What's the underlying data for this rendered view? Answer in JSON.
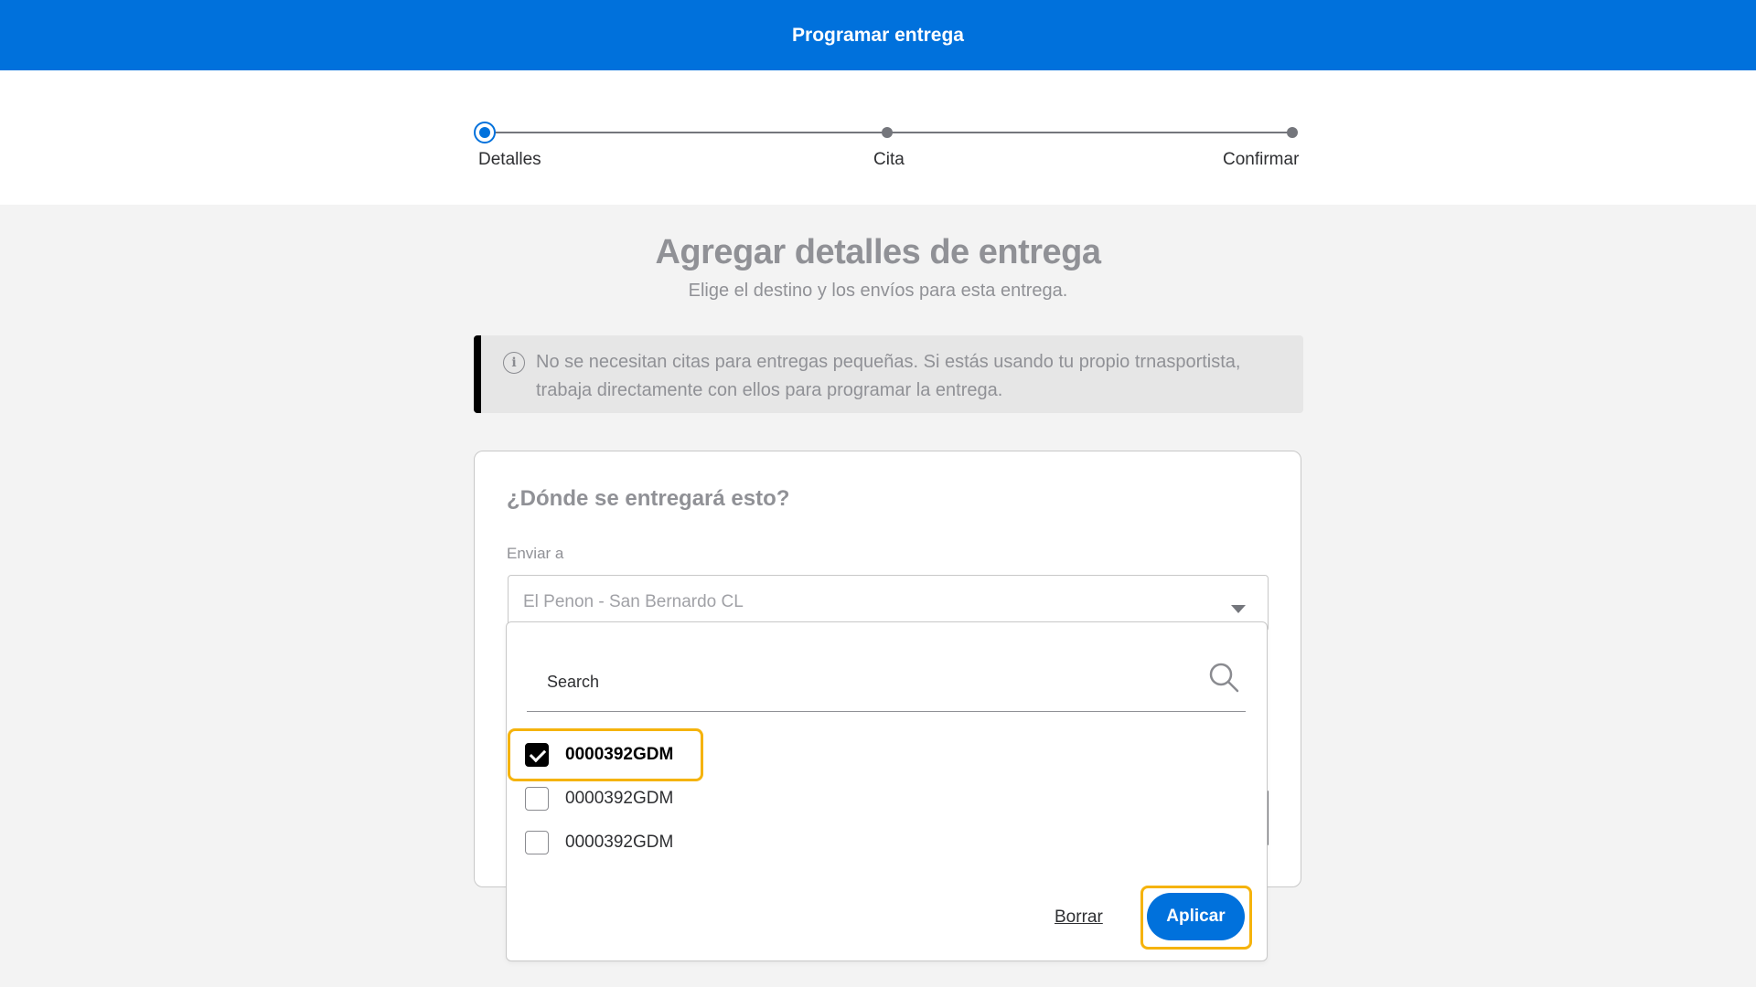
{
  "header": {
    "title": "Programar entrega"
  },
  "stepper": {
    "steps": [
      {
        "label": "Detalles",
        "state": "active"
      },
      {
        "label": "Cita",
        "state": "pending"
      },
      {
        "label": "Confirmar",
        "state": "pending"
      }
    ]
  },
  "main": {
    "title": "Agregar detalles de entrega",
    "subtitle": "Elige el destino y los envíos para esta entrega.",
    "info_banner": {
      "icon": "info-icon",
      "text": "No se necesitan citas para entregas pequeñas. Si estás usando tu propio trnasportista, trabaja directamente con ellos para programar la entrega."
    },
    "card": {
      "question": "¿Dónde se entregará esto?",
      "ship_to_label": "Enviar a",
      "ship_to_value": "El Penon - San Bernardo CL"
    }
  },
  "dropdown": {
    "search_placeholder": "Search",
    "options": [
      {
        "label": "0000392GDM",
        "checked": true
      },
      {
        "label": "0000392GDM",
        "checked": false
      },
      {
        "label": "0000392GDM",
        "checked": false
      }
    ],
    "clear_label": "Borrar",
    "apply_label": "Aplicar"
  },
  "colors": {
    "primary": "#0071dc",
    "highlight": "#f5b30c",
    "banner_bg": "#e6e6e6",
    "page_bg": "#f3f3f3"
  }
}
